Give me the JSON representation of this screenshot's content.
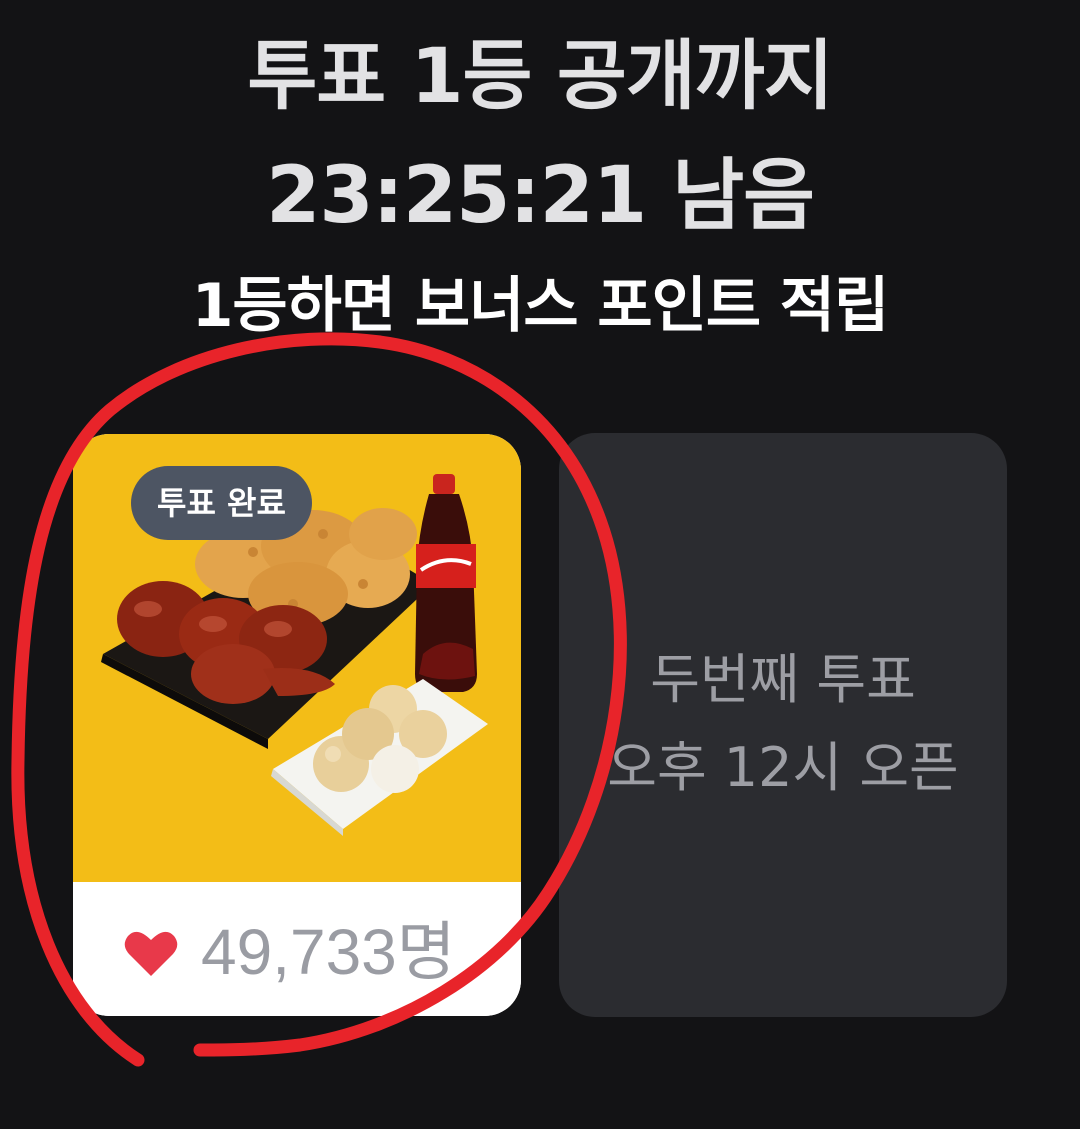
{
  "header": {
    "title_line1": "투표 1등 공개까지",
    "countdown": "23:25:21 남음",
    "subtitle": "1등하면 보너스 포인트 적립"
  },
  "cards": [
    {
      "badge": "투표 완료",
      "vote_count": "49,733명",
      "heart_icon": "heart-icon",
      "image": "fried-chicken-cola-cheese-balls"
    },
    {
      "line1": "두번째 투표",
      "line2": "오후 12시 오픈"
    }
  ],
  "colors": {
    "background": "#131315",
    "card_yellow": "#f3bd17",
    "badge": "#4d5563",
    "heart": "#e8394a",
    "upcoming_card": "#2b2c30",
    "annotation_circle": "#e8242a"
  }
}
